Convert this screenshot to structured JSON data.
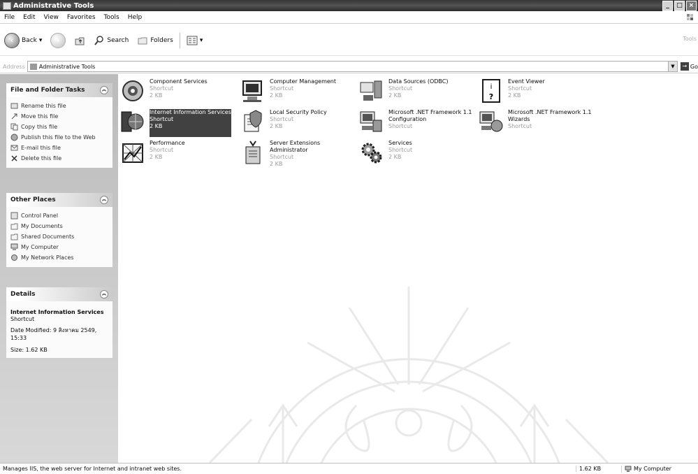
{
  "window": {
    "title": "Administrative Tools"
  },
  "menu": [
    "File",
    "Edit",
    "View",
    "Favorites",
    "Tools",
    "Help"
  ],
  "toolbar": {
    "back": "Back",
    "search": "Search",
    "folders": "Folders",
    "right_label": "Tools"
  },
  "address": {
    "label": "Address",
    "value": "Administrative Tools",
    "go": "Go"
  },
  "file_tasks": {
    "title": "File and Folder Tasks",
    "items": [
      "Rename this file",
      "Move this file",
      "Copy this file",
      "Publish this file to the Web",
      "E-mail this file",
      "Delete this file"
    ]
  },
  "other_places": {
    "title": "Other Places",
    "items": [
      "Control Panel",
      "My Documents",
      "Shared Documents",
      "My Computer",
      "My Network Places"
    ]
  },
  "details": {
    "title": "Details",
    "name": "Internet Information Services",
    "type": "Shortcut",
    "modified": "Date Modified: 9 สิงหาคม 2549, 15:33",
    "size": "Size: 1.62 KB"
  },
  "items": [
    {
      "name": "Component Services",
      "type": "Shortcut",
      "size": "2 KB",
      "icon": "component-services-icon"
    },
    {
      "name": "Computer Management",
      "type": "Shortcut",
      "size": "2 KB",
      "icon": "computer-management-icon"
    },
    {
      "name": "Data Sources (ODBC)",
      "type": "Shortcut",
      "size": "2 KB",
      "icon": "data-sources-icon"
    },
    {
      "name": "Event Viewer",
      "type": "Shortcut",
      "size": "2 KB",
      "icon": "event-viewer-icon"
    },
    {
      "name": "Internet Information Services",
      "type": "Shortcut",
      "size": "2 KB",
      "icon": "iis-icon",
      "selected": true
    },
    {
      "name": "Local Security Policy",
      "type": "Shortcut",
      "size": "2 KB",
      "icon": "local-security-policy-icon"
    },
    {
      "name": "Microsoft .NET Framework 1.1 Configuration",
      "type": "Shortcut",
      "size": "",
      "icon": "net-framework-configuration-icon"
    },
    {
      "name": "Microsoft .NET Framework 1.1 Wizards",
      "type": "Shortcut",
      "size": "",
      "icon": "net-framework-wizards-icon"
    },
    {
      "name": "Performance",
      "type": "Shortcut",
      "size": "2 KB",
      "icon": "performance-icon"
    },
    {
      "name": "Server Extensions Administrator",
      "type": "Shortcut",
      "size": "2 KB",
      "icon": "server-extensions-icon"
    },
    {
      "name": "Services",
      "type": "Shortcut",
      "size": "2 KB",
      "icon": "services-icon"
    }
  ],
  "status": {
    "text": "Manages IIS, the web server for Internet and intranet web sites.",
    "size": "1.62 KB",
    "zone": "My Computer"
  }
}
